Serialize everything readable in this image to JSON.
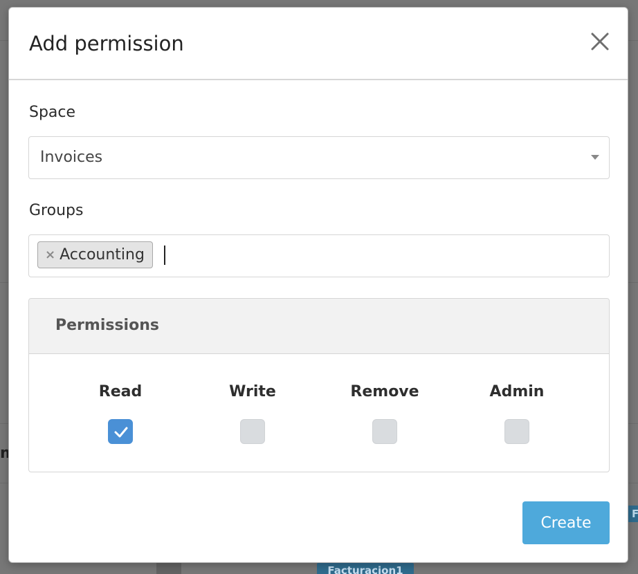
{
  "background": {
    "partial_text": "m",
    "tag_right_partial": "F",
    "tag_bottom": "Facturacion1"
  },
  "modal": {
    "title": "Add permission",
    "close_icon": "close-icon",
    "space": {
      "label": "Space",
      "value": "Invoices"
    },
    "groups": {
      "label": "Groups",
      "tags": [
        "Accounting"
      ],
      "remove_symbol": "×"
    },
    "permissions": {
      "heading": "Permissions",
      "items": [
        {
          "label": "Read",
          "checked": true
        },
        {
          "label": "Write",
          "checked": false
        },
        {
          "label": "Remove",
          "checked": false
        },
        {
          "label": "Admin",
          "checked": false
        }
      ]
    },
    "create_label": "Create"
  },
  "colors": {
    "accent": "#4ea9db",
    "checkbox_checked": "#4a90d6",
    "checkbox_unchecked": "#d9dcdf",
    "overlay": "#777777"
  }
}
